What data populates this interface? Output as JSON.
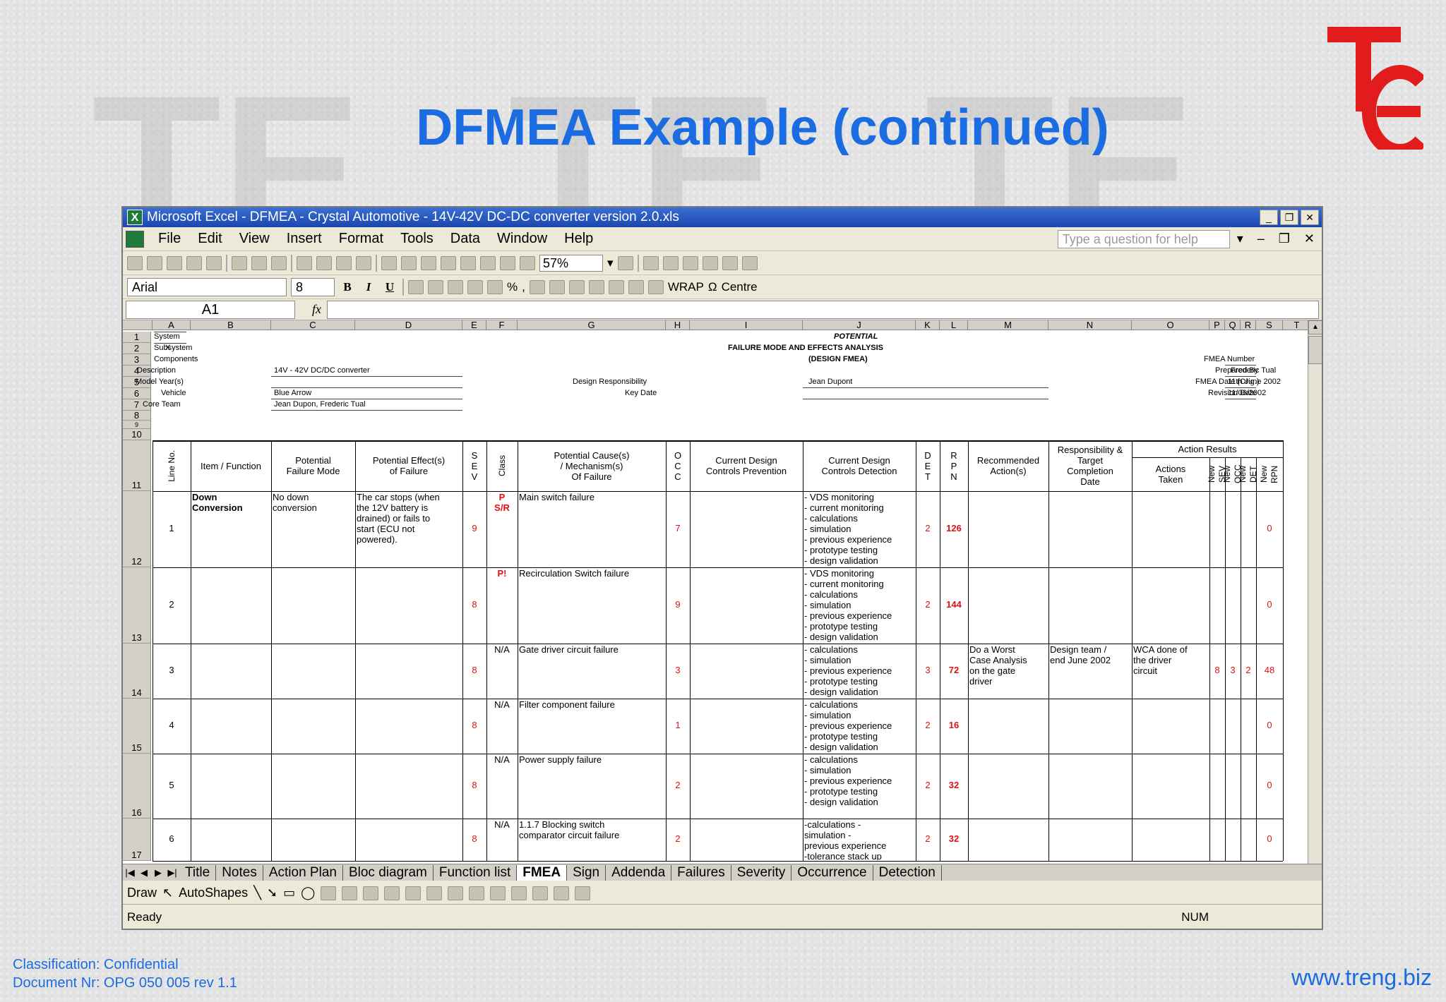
{
  "slide": {
    "title": "DFMEA Example (continued)",
    "footer": {
      "classification": "Classification: Confidential",
      "document": "Document Nr: OPG 050 005 rev 1.1",
      "website": "www.treng.biz"
    },
    "colors": {
      "title": "#1a6ce0",
      "logo": "#e21c1c",
      "rpn": "#e01010"
    }
  },
  "window": {
    "title": "Microsoft Excel - DFMEA - Crystal Automotive - 14V-42V DC-DC converter version 2.0.xls"
  },
  "menubar": {
    "items": [
      "File",
      "Edit",
      "View",
      "Insert",
      "Format",
      "Tools",
      "Data",
      "Window",
      "Help"
    ],
    "help_placeholder": "Type a question for help"
  },
  "toolbar": {
    "zoom": "57%",
    "font": "Arial",
    "font_size": "8",
    "bold": "B",
    "italic": "I",
    "underline": "U",
    "percent": "%",
    "comma": ",",
    "wrap": "WRAP",
    "centre": "Centre"
  },
  "formula": {
    "cell_ref": "A1",
    "fx": "fx"
  },
  "columns": [
    "A",
    "B",
    "C",
    "D",
    "E",
    "F",
    "G",
    "H",
    "I",
    "J",
    "K",
    "L",
    "M",
    "N",
    "O",
    "P",
    "Q",
    "R",
    "S",
    "T"
  ],
  "rows": [
    "1",
    "2",
    "3",
    "4",
    "5",
    "6",
    "7",
    "8",
    "9",
    "10",
    "11",
    "12",
    "13",
    "14",
    "15",
    "16",
    "17"
  ],
  "header_block": {
    "system": "System",
    "x": "X",
    "subsystem": "Subsystem",
    "components": "Components",
    "description_label": "Description",
    "description": "14V - 42V DC/DC converter",
    "model_label": "Model Year(s)",
    "vehicle_label": "Vehicle",
    "vehicle": "Blue Arrow",
    "core_team_label": "Core Team",
    "core_team": "Jean Dupon, Frederic Tual",
    "design_resp_label": "Design Responsibility",
    "key_date_label": "Key Date",
    "potential": "POTENTIAL",
    "fmea_title": "FAILURE MODE AND EFFECTS ANALYSIS",
    "design_fmea": "(DESIGN FMEA)",
    "design_resp": "Jean Dupont",
    "fmea_number_label": "FMEA Number",
    "prepared_by_label": "Prepared By",
    "prepared_by": "Frederic Tual",
    "fmea_date_label": "FMEA Date (Orig.)",
    "fmea_date": "11th June 2002",
    "revision_date_label": "Revision Date",
    "revision_date": "11/06/2002"
  },
  "table_headers": {
    "line_no": "Line No.",
    "item": "Item / Function",
    "failure_mode": "Potential\nFailure Mode",
    "effects": "Potential Effect(s)\nof Failure",
    "sev": "S\nE\nV",
    "class": "Class",
    "cause": "Potential Cause(s)\n/ Mechanism(s)\nOf Failure",
    "occ": "O\nC\nC",
    "prevention": "Current Design\nControls Prevention",
    "detection": "Current Design\nControls Detection",
    "det": "D\nE\nT",
    "rpn": "R\nP\nN",
    "recommended": "Recommended\nAction(s)",
    "responsibility": "Responsibility &\nTarget\nCompletion\nDate",
    "action_results": "Action Results",
    "actions_taken": "Actions\nTaken",
    "new_sev": "New SEV",
    "new_occ": "New OCC",
    "new_det": "New DET",
    "new_rpn": "New RPN"
  },
  "table_rows": [
    {
      "line": "1",
      "item": "Down\nConversion",
      "mode": "No down\nconversion",
      "effect": "The car stops (when\nthe 12V battery is\ndrained) or fails to\nstart (ECU not\npowered).",
      "sev": "9",
      "class": "P\nS/R",
      "cause": "Main switch failure",
      "occ": "7",
      "prevention": "",
      "detection": "- VDS monitoring\n- current monitoring\n- calculations\n- simulation\n- previous experience\n- prototype testing\n- design validation",
      "det": "2",
      "rpn": "126",
      "recommended": "",
      "responsibility": "",
      "taken": "",
      "nsev": "",
      "nocc": "",
      "ndet": "",
      "nrpn": "0"
    },
    {
      "line": "2",
      "item": "",
      "mode": "",
      "effect": "",
      "sev": "8",
      "class": "P!",
      "cause": "Recirculation Switch failure",
      "occ": "9",
      "prevention": "",
      "detection": "- VDS monitoring\n- current monitoring\n- calculations\n- simulation\n- previous experience\n- prototype testing\n- design validation",
      "det": "2",
      "rpn": "144",
      "recommended": "",
      "responsibility": "",
      "taken": "",
      "nsev": "",
      "nocc": "",
      "ndet": "",
      "nrpn": "0"
    },
    {
      "line": "3",
      "item": "",
      "mode": "",
      "effect": "",
      "sev": "8",
      "class": "N/A",
      "cause": "Gate driver circuit failure",
      "occ": "3",
      "prevention": "",
      "detection": "- calculations\n- simulation\n- previous experience\n- prototype testing\n- design validation",
      "det": "3",
      "rpn": "72",
      "recommended": "Do a Worst\nCase Analysis\non the gate\ndriver",
      "responsibility": "Design team /\nend June 2002",
      "taken": "WCA done of\nthe driver\ncircuit",
      "nsev": "8",
      "nocc": "3",
      "ndet": "2",
      "nrpn": "48"
    },
    {
      "line": "4",
      "item": "",
      "mode": "",
      "effect": "",
      "sev": "8",
      "class": "N/A",
      "cause": "Filter component failure",
      "occ": "1",
      "prevention": "",
      "detection": "- calculations\n- simulation\n- previous experience\n- prototype testing\n- design validation",
      "det": "2",
      "rpn": "16",
      "recommended": "",
      "responsibility": "",
      "taken": "",
      "nsev": "",
      "nocc": "",
      "ndet": "",
      "nrpn": "0"
    },
    {
      "line": "5",
      "item": "",
      "mode": "",
      "effect": "",
      "sev": "8",
      "class": "N/A",
      "cause": "Power supply failure",
      "occ": "2",
      "prevention": "",
      "detection": "- calculations\n- simulation\n- previous experience\n- prototype testing\n- design validation",
      "det": "2",
      "rpn": "32",
      "recommended": "",
      "responsibility": "",
      "taken": "",
      "nsev": "",
      "nocc": "",
      "ndet": "",
      "nrpn": "0"
    },
    {
      "line": "6",
      "item": "",
      "mode": "",
      "effect": "",
      "sev": "8",
      "class": "N/A",
      "cause": "1.1.7  Blocking switch\ncomparator circuit failure",
      "occ": "2",
      "prevention": "",
      "detection": "-calculations       -\nsimulation        -\nprevious experience\n-tolerance stack up",
      "det": "2",
      "rpn": "32",
      "recommended": "",
      "responsibility": "",
      "taken": "",
      "nsev": "",
      "nocc": "",
      "ndet": "",
      "nrpn": "0"
    }
  ],
  "sheet_tabs": [
    "Title",
    "Notes",
    "Action Plan",
    "Bloc diagram",
    "Function list",
    "FMEA",
    "Sign",
    "Addenda",
    "Failures",
    "Severity",
    "Occurrence",
    "Detection"
  ],
  "active_tab": "FMEA",
  "drawbar": {
    "draw": "Draw",
    "autoshapes": "AutoShapes"
  },
  "status": {
    "ready": "Ready",
    "num": "NUM"
  }
}
